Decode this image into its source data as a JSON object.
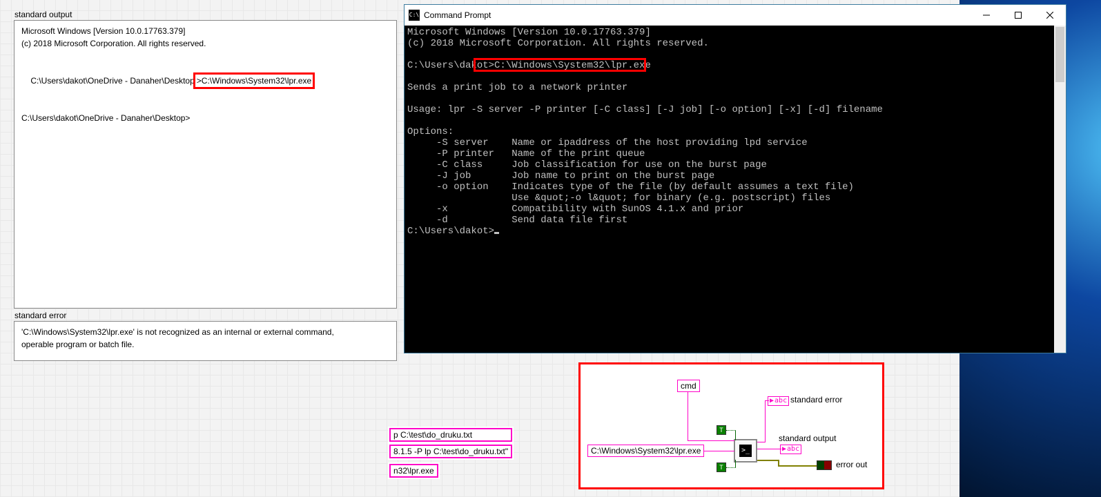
{
  "left_panel": {
    "stdout": {
      "title": "standard output",
      "line1": "Microsoft Windows [Version 10.0.17763.379]",
      "line2": "(c) 2018 Microsoft Corporation. All rights reserved.",
      "line3_pre": "C:\\Users\\dakot\\OneDrive - Danaher\\Desktop",
      "line3_red": ">C:\\Windows\\System32\\lpr.exe",
      "line4": "C:\\Users\\dakot\\OneDrive - Danaher\\Desktop>"
    },
    "stderr": {
      "title": "standard error",
      "line1": "'C:\\Windows\\System32\\lpr.exe' is not recognized as an internal or external command,",
      "line2": "operable program or batch file."
    }
  },
  "cmd": {
    "title": "Command Prompt",
    "icon_text": "C:\\",
    "body": "Microsoft Windows [Version 10.0.17763.379]\n(c) 2018 Microsoft Corporation. All rights reserved.\n\nC:\\Users\\dakot>C:\\Windows\\System32\\lpr.exe\n\nSends a print job to a network printer\n\nUsage: lpr -S server -P printer [-C class] [-J job] [-o option] [-x] [-d] filename\n\nOptions:\n     -S server    Name or ipaddress of the host providing lpd service\n     -P printer   Name of the print queue\n     -C class     Job classification for use on the burst page\n     -J job       Job name to print on the burst page\n     -o option    Indicates type of the file (by default assumes a text file)\n                  Use &quot;-o l&quot; for binary (e.g. postscript) files\n     -x           Compatibility with SunOS 4.1.x and prior\n     -d           Send data file first\nC:\\Users\\dakot>"
  },
  "snippets": {
    "s1": "p C:\\test\\do_druku.txt",
    "s2": "8.1.5 -P lp C:\\test\\do_druku.txt\"",
    "s3": "n32\\lpr.exe"
  },
  "diagram": {
    "cmd_label": "cmd",
    "string_const": "C:\\Windows\\System32\\lpr.exe",
    "stderr_label": "standard error",
    "stdout_label": "standard output",
    "errorout_label": "error out",
    "t_glyph": "T",
    "abc_glyph": "abc",
    "exec_glyph": ">_"
  }
}
